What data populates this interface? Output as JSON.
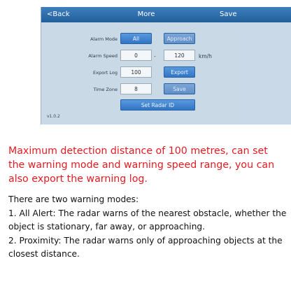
{
  "screen": {
    "back_label": "<Back",
    "title": "More",
    "save_label": "Save",
    "rows": {
      "alarm_mode": {
        "label": "Alarm Mode",
        "option_all": "All",
        "option_approach": "Approach"
      },
      "alarm_speed": {
        "label": "Alarm Speed",
        "min": "0",
        "separator": "-",
        "max": "120",
        "unit": "km/h"
      },
      "export_log": {
        "label": "Export Log",
        "value": "100",
        "button": "Export"
      },
      "time_zone": {
        "label": "Time Zone",
        "value": "8",
        "button": "Save"
      }
    },
    "set_radar_id": "Set Radar ID",
    "version": "v1.0.2"
  },
  "caption": "Maximum detection distance of 100 metres, can set the warning mode and warning speed range, you can also export the warning log.",
  "body": {
    "intro": "There are two warning modes:",
    "mode1": "1. All Alert: The radar warns of the nearest obstacle, whether the object is stationary, far away, or approaching.",
    "mode2": "2. Proximity: The radar warns only of approaching objects at the closest distance."
  },
  "colors": {
    "caption_red": "#e31b23",
    "accent_blue": "#2f72c2",
    "screen_bg": "#c9d9e8"
  }
}
